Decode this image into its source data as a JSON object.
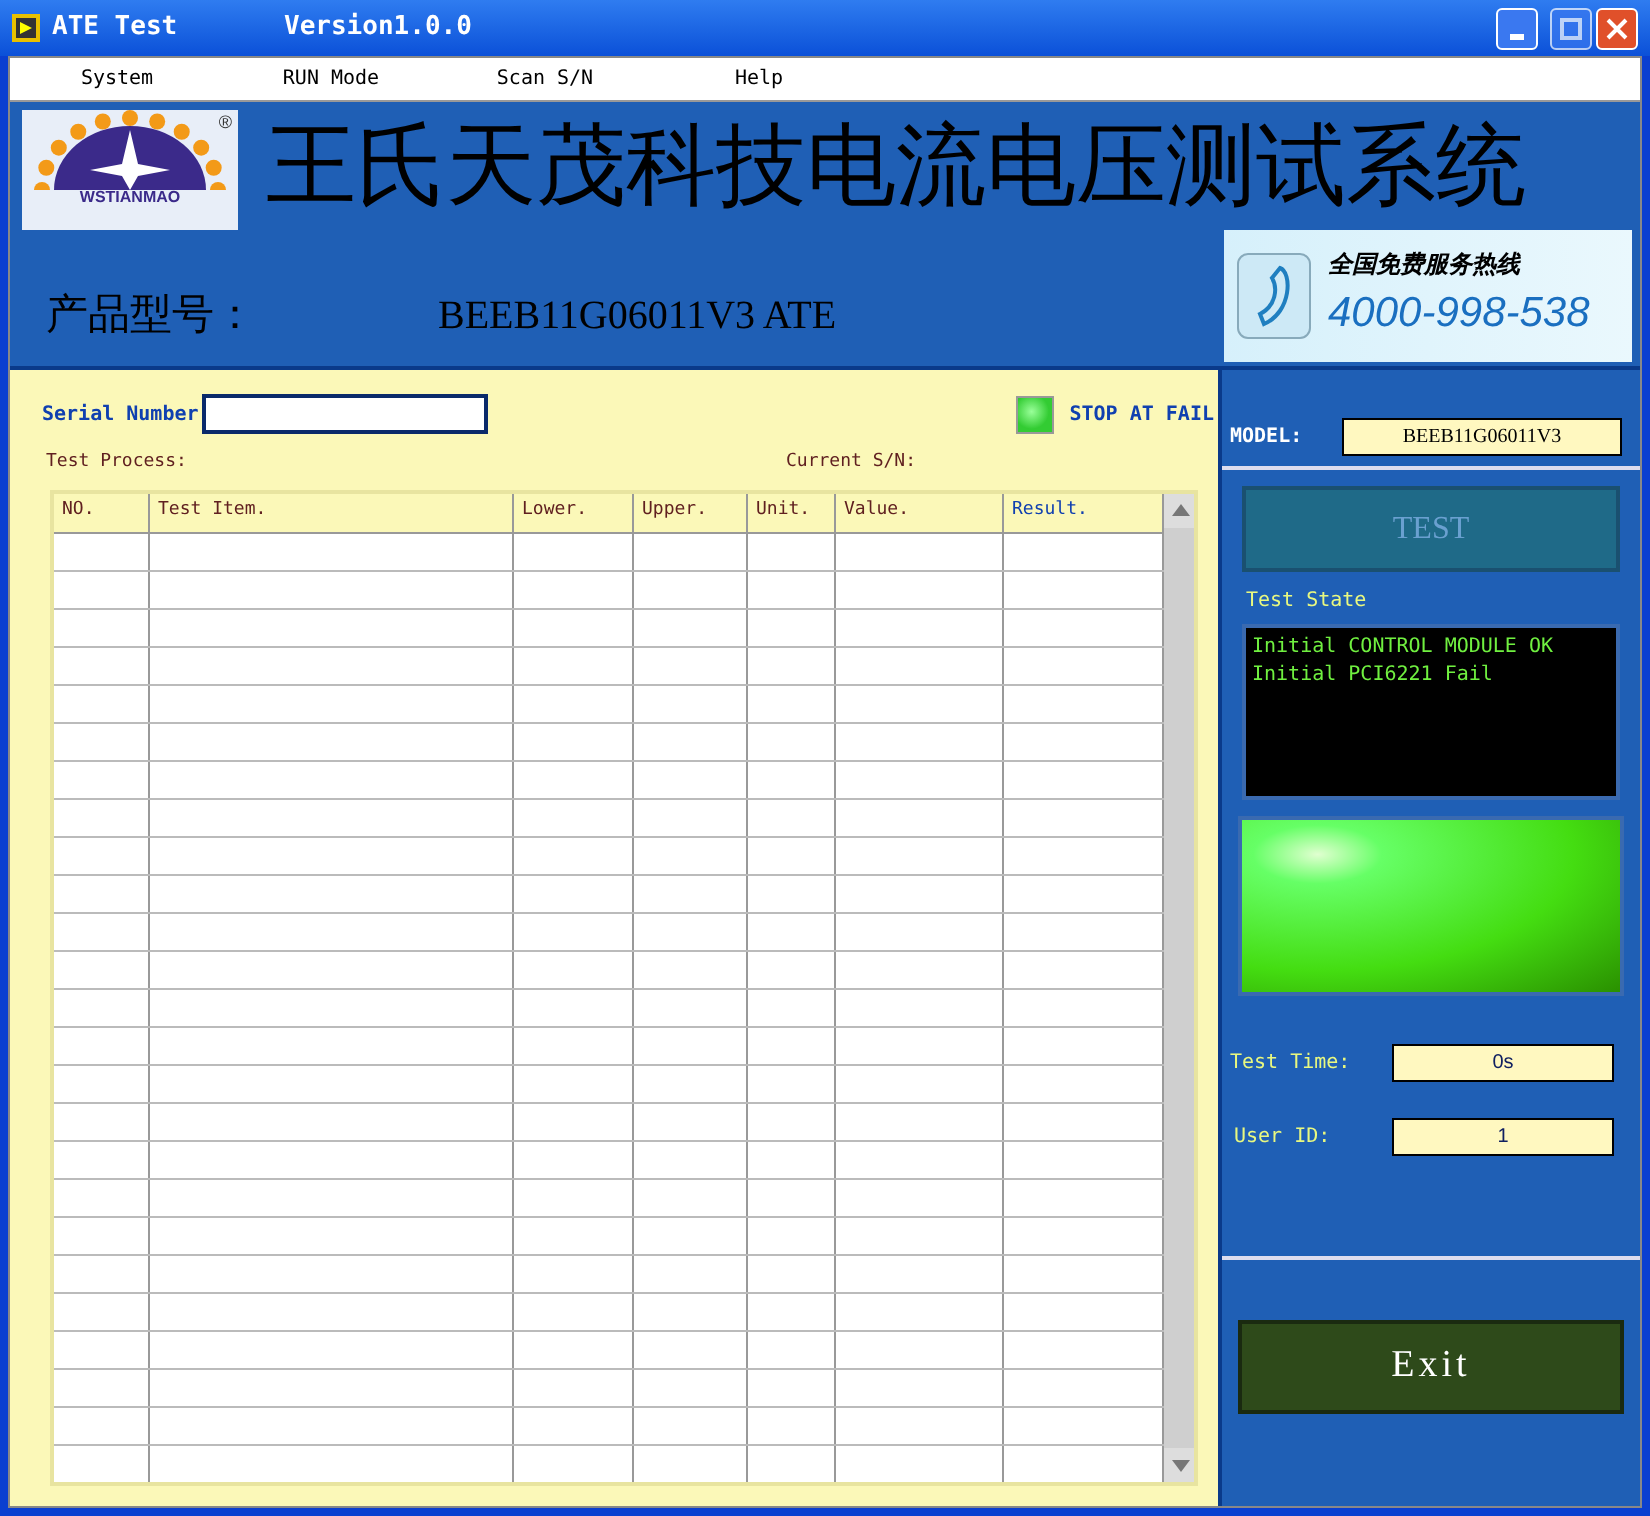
{
  "window": {
    "title": "ATE Test",
    "version": "Version1.0.0"
  },
  "menu": [
    "System",
    "RUN Mode",
    "Scan S/N",
    "Help"
  ],
  "header": {
    "logo_text": "WSTIANMAO",
    "logo_mark": "®",
    "title": "王氏天茂科技电流电压测试系统",
    "model_label": "产品型号：",
    "model_value": "BEEB11G06011V3 ATE",
    "hotline_label": "全国免费服务热线",
    "hotline_number": "4000-998-538"
  },
  "serial": {
    "label": "Serial Number"
  },
  "stop_at_fail": {
    "label": "STOP AT FAIL",
    "on": true
  },
  "test_process_label": "Test Process:",
  "current_sn_label": "Current S/N:",
  "table": {
    "columns": [
      "NO.",
      "Test Item.",
      "Lower.",
      "Upper.",
      "Unit.",
      "Value.",
      "Result."
    ]
  },
  "side": {
    "model_label": "MODEL:",
    "model_value": "BEEB11G06011V3",
    "test_button": {
      "label": "TEST",
      "disabled": true
    },
    "test_state_label": "Test State",
    "log": [
      "Initial CONTROL MODULE OK",
      "Initial PCI6221 Fail"
    ],
    "lamp_on": true,
    "test_time_label": "Test Time:",
    "test_time": "0s",
    "user_id_label": "User ID:",
    "user_id": "1",
    "exit_button": "Exit"
  }
}
